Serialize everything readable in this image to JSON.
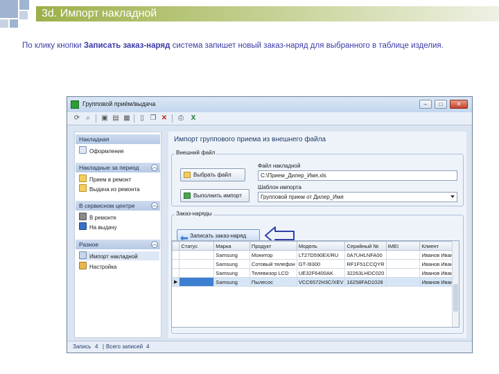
{
  "slide": {
    "number": "3d.",
    "title": "Импорт накладной",
    "caption_before": "По клику кнопки ",
    "caption_bold": "Записать заказ-наряд",
    "caption_after": " система запишет новый заказ-наряд для выбранного в таблице изделия."
  },
  "window": {
    "title": "Групповой приём/выдача"
  },
  "nav": {
    "groups": [
      {
        "header": "Накладная",
        "items": [
          {
            "label": "Оформление",
            "icon": "form-icon"
          }
        ]
      },
      {
        "header": "Накладные за период",
        "items": [
          {
            "label": "Прием в ремонт",
            "icon": "folder-icon"
          },
          {
            "label": "Выдача из ремонта",
            "icon": "folder-icon"
          }
        ]
      },
      {
        "header": "В сервисном центре",
        "items": [
          {
            "label": "В ремонте",
            "icon": "tools-icon"
          },
          {
            "label": "На выдачу",
            "icon": "cart-icon"
          }
        ]
      },
      {
        "header": "Разное",
        "items": [
          {
            "label": "Импорт накладной",
            "icon": "import-icon",
            "selected": true
          },
          {
            "label": "Настройка",
            "icon": "settings-icon"
          }
        ]
      }
    ]
  },
  "main": {
    "title": "Импорт группового приема из внешнего файла",
    "external_file": {
      "legend": "Внешний файл",
      "choose_button": "Выбрать файл",
      "import_button": "Выполнить импорт",
      "file_label": "Файл накладной",
      "file_value": "C:\\Прием_Дилер_Имя.xls",
      "template_label": "Шаблон импорта",
      "template_value": "Групповой прием от Дилер_Имя"
    },
    "orders": {
      "legend": "Заказ-наряды",
      "save_button": "Записать заказ-наряд",
      "columns": [
        "Статус",
        "Марка",
        "Продукт",
        "Модель",
        "Серийный №",
        "IMEI",
        "Клиент"
      ],
      "rows": [
        [
          "",
          "Samsung",
          "Монитор",
          "LT27D590EX/RU",
          "0A7UHLNFA00",
          "",
          "Иванов Иван"
        ],
        [
          "",
          "Samsung",
          "Сотовый телефон",
          "GT-I9300",
          "RF1F51CCQYR",
          "",
          "Иванов Иван"
        ],
        [
          "",
          "Samsung",
          "Телевизор LCD",
          "UE32F6400AK",
          "32263LHDC020",
          "",
          "Иванов Иван"
        ],
        [
          "",
          "Samsung",
          "Пылесос",
          "VCC6572H3C/XEV",
          "16258FAD1028",
          "",
          "Иванов Иван"
        ]
      ],
      "current_row": 3
    }
  },
  "status": {
    "record_label": "Запись",
    "record_value": "4",
    "total_label": "Всего записей",
    "total_value": "4"
  },
  "colors": {
    "title_bar": "#9bb049",
    "caption_text": "#3a3aa8",
    "arrow": "#2f3fa8"
  }
}
